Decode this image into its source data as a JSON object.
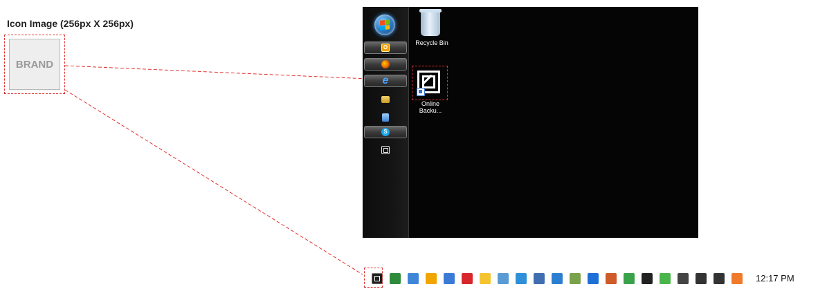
{
  "header": {
    "title": "Icon Image (256px X 256px)"
  },
  "brand_placeholder": {
    "label": "BRAND"
  },
  "desktop": {
    "sidebar_items": [
      {
        "icon": "outlook-icon",
        "active": true
      },
      {
        "icon": "firefox-icon",
        "active": true
      },
      {
        "icon": "internet-explorer-icon",
        "active": true,
        "glyph": "e"
      },
      {
        "icon": "folder-icon",
        "active": false
      },
      {
        "icon": "notes-icon",
        "active": false
      },
      {
        "icon": "skype-icon",
        "active": true,
        "glyph": "S"
      },
      {
        "icon": "online-backup-icon",
        "active": false
      }
    ],
    "icons": {
      "recycle_bin": "Recycle Bin",
      "online_backup_line1": "Online",
      "online_backup_line2": "Backu..."
    }
  },
  "taskbar": {
    "tray_icons": [
      {
        "name": "online-backup-tray-icon",
        "color": "#1f1f1f"
      },
      {
        "name": "app-tray-icon-1",
        "color": "#2e8b3a"
      },
      {
        "name": "app-tray-icon-2",
        "color": "#3f86d9"
      },
      {
        "name": "outlook-tray-icon",
        "color": "#f0a500"
      },
      {
        "name": "app-tray-icon-3",
        "color": "#3b7bd6"
      },
      {
        "name": "app-tray-icon-4",
        "color": "#d9262c"
      },
      {
        "name": "app-tray-icon-5",
        "color": "#f4c430"
      },
      {
        "name": "app-tray-icon-6",
        "color": "#5a9bd5"
      },
      {
        "name": "app-tray-icon-7",
        "color": "#2f8fd8"
      },
      {
        "name": "app-tray-icon-8",
        "color": "#3f6fb0"
      },
      {
        "name": "app-tray-icon-9",
        "color": "#2c7fd0"
      },
      {
        "name": "app-tray-icon-10",
        "color": "#7aa24a"
      },
      {
        "name": "bluetooth-icon",
        "color": "#1e6fd6"
      },
      {
        "name": "app-tray-icon-11",
        "color": "#cf5a2a"
      },
      {
        "name": "wireless-icon",
        "color": "#3aa24a"
      },
      {
        "name": "action-center-flag-icon",
        "color": "#222222"
      },
      {
        "name": "security-check-icon",
        "color": "#49b54a"
      },
      {
        "name": "power-icon",
        "color": "#444444"
      },
      {
        "name": "signal-bars-icon",
        "color": "#333333"
      },
      {
        "name": "volume-icon",
        "color": "#333333"
      },
      {
        "name": "app-tray-icon-12",
        "color": "#f07a2a"
      }
    ],
    "clock": "12:17 PM"
  }
}
